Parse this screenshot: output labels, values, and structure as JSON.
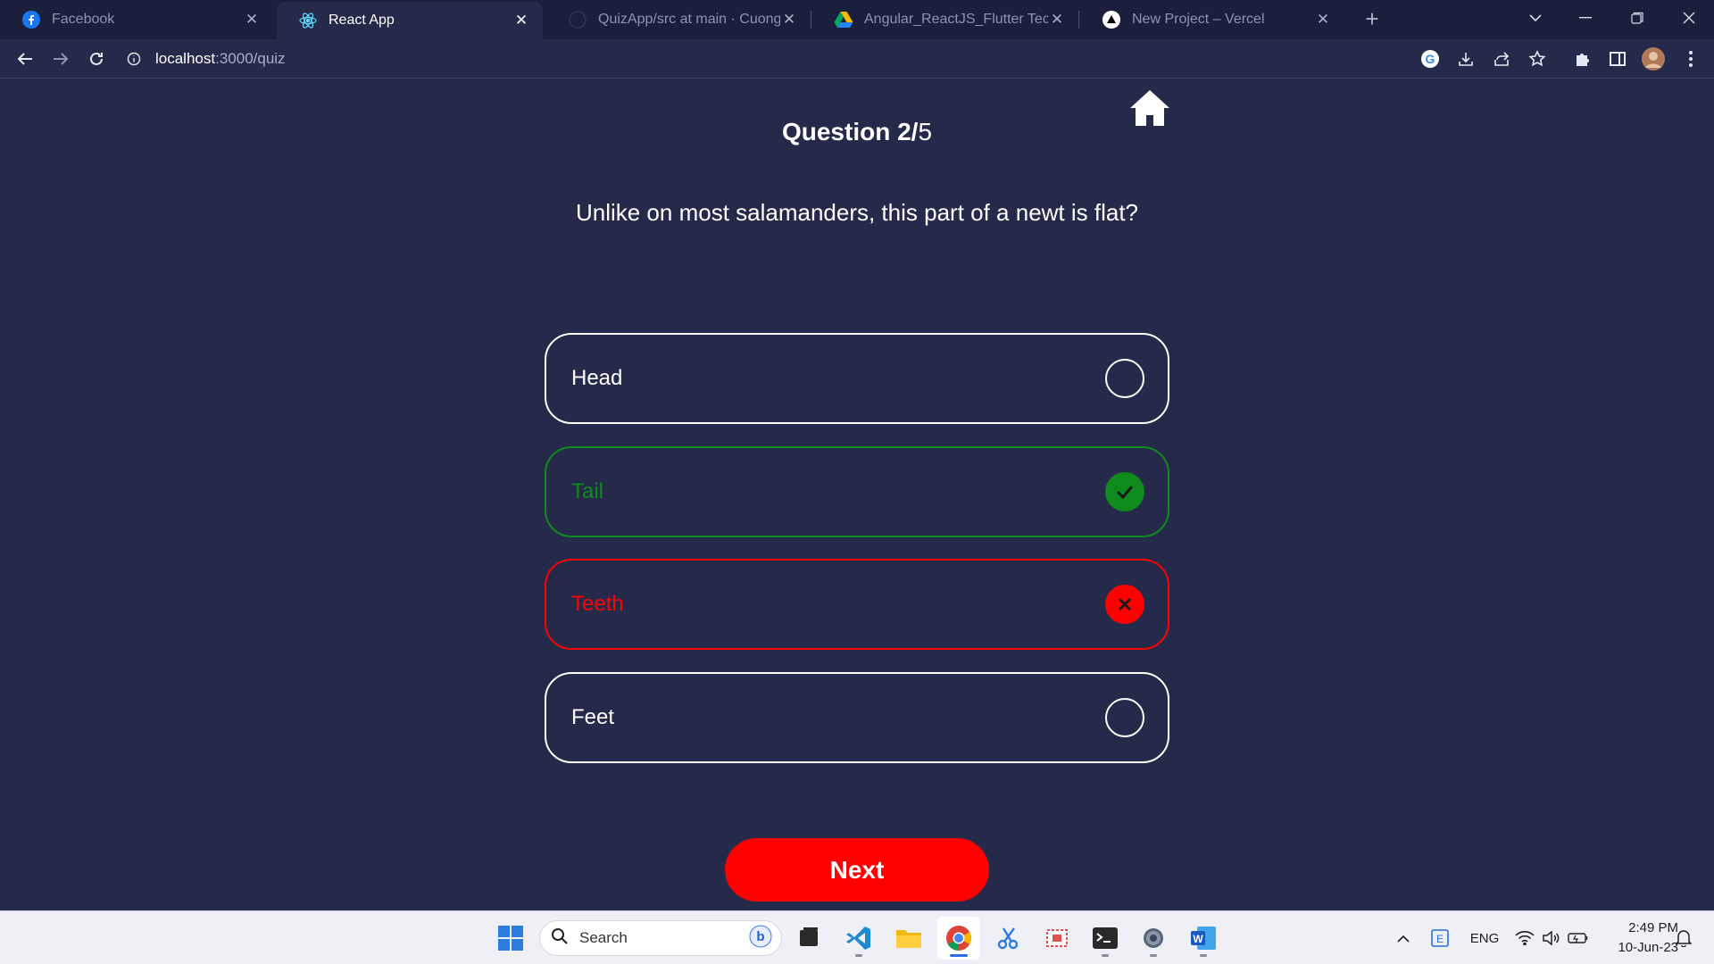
{
  "browser": {
    "tabs": [
      {
        "title": "Facebook",
        "icon": "facebook-icon",
        "active": false
      },
      {
        "title": "React App",
        "icon": "react-icon",
        "active": true
      },
      {
        "title": "QuizApp/src at main · CuongGo",
        "icon": "github-icon",
        "active": false
      },
      {
        "title": "Angular_ReactJS_Flutter Technica",
        "icon": "google-drive-icon",
        "active": false
      },
      {
        "title": "New Project – Vercel",
        "icon": "vercel-icon",
        "active": false
      }
    ],
    "url_host": "localhost",
    "url_path": ":3000/quiz"
  },
  "quiz": {
    "counter_prefix": "Question 2/",
    "counter_total": "5",
    "question": "Unlike on most salamanders, this part of a newt is flat?",
    "answers": [
      {
        "label": "Head",
        "state": "unselected"
      },
      {
        "label": "Tail",
        "state": "correct"
      },
      {
        "label": "Teeth",
        "state": "wrong"
      },
      {
        "label": "Feet",
        "state": "unselected"
      }
    ],
    "next_label": "Next"
  },
  "taskbar": {
    "search_placeholder": "Search",
    "language": "ENG",
    "time": "2:49 PM",
    "date": "10-Jun-23"
  },
  "colors": {
    "page_background": "#262a4a",
    "correct": "#0f8a1c",
    "wrong": "#ff0000",
    "next_button": "#ff0000"
  }
}
